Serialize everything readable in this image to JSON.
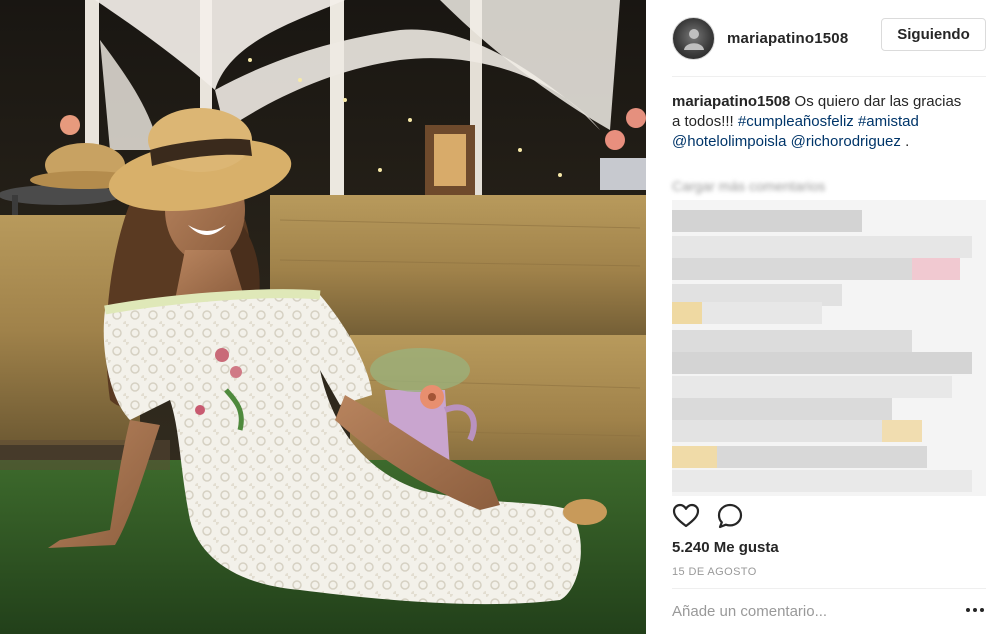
{
  "header": {
    "username": "mariapatino1508",
    "follow_label": "Siguiendo"
  },
  "caption": {
    "username": "mariapatino1508",
    "text": " Os quiero dar las gracias a todos!!! ",
    "hashtag1": "#cumpleañosfeliz",
    "hashtag2": "#amistad",
    "mention1": "@hotelolimpoisla",
    "mention2": "@richorodriguez",
    "trailing": " ."
  },
  "comments": {
    "load_more_label": "Cargar más comentarios"
  },
  "actions": {
    "like_icon": "heart-icon",
    "comment_icon": "comment-icon"
  },
  "stats": {
    "likes": "5.240 Me gusta",
    "date": "15 de agosto"
  },
  "comment_box": {
    "placeholder": "Añade un comentario...",
    "more_icon": "ellipsis-icon"
  },
  "colors": {
    "link": "#003569",
    "muted": "#999999",
    "text": "#262626",
    "border": "#dbdbdb"
  }
}
